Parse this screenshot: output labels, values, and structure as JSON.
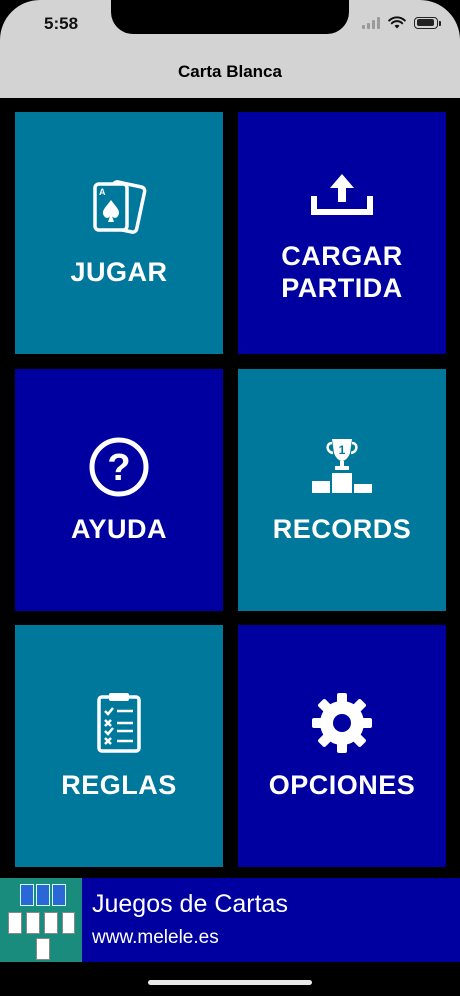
{
  "status_bar": {
    "time": "5:58"
  },
  "nav": {
    "title": "Carta Blanca"
  },
  "menu": {
    "jugar": "JUGAR",
    "cargar_partida": "CARGAR\nPARTIDA",
    "ayuda": "AYUDA",
    "records": "RECORDS",
    "reglas": "REGLAS",
    "opciones": "OPCIONES"
  },
  "ad": {
    "title": "Juegos de Cartas",
    "url": "www.melele.es"
  },
  "colors": {
    "teal": "#00789b",
    "navy": "#0000a0",
    "background": "#000000",
    "nav_bar": "#d3d3d3"
  }
}
